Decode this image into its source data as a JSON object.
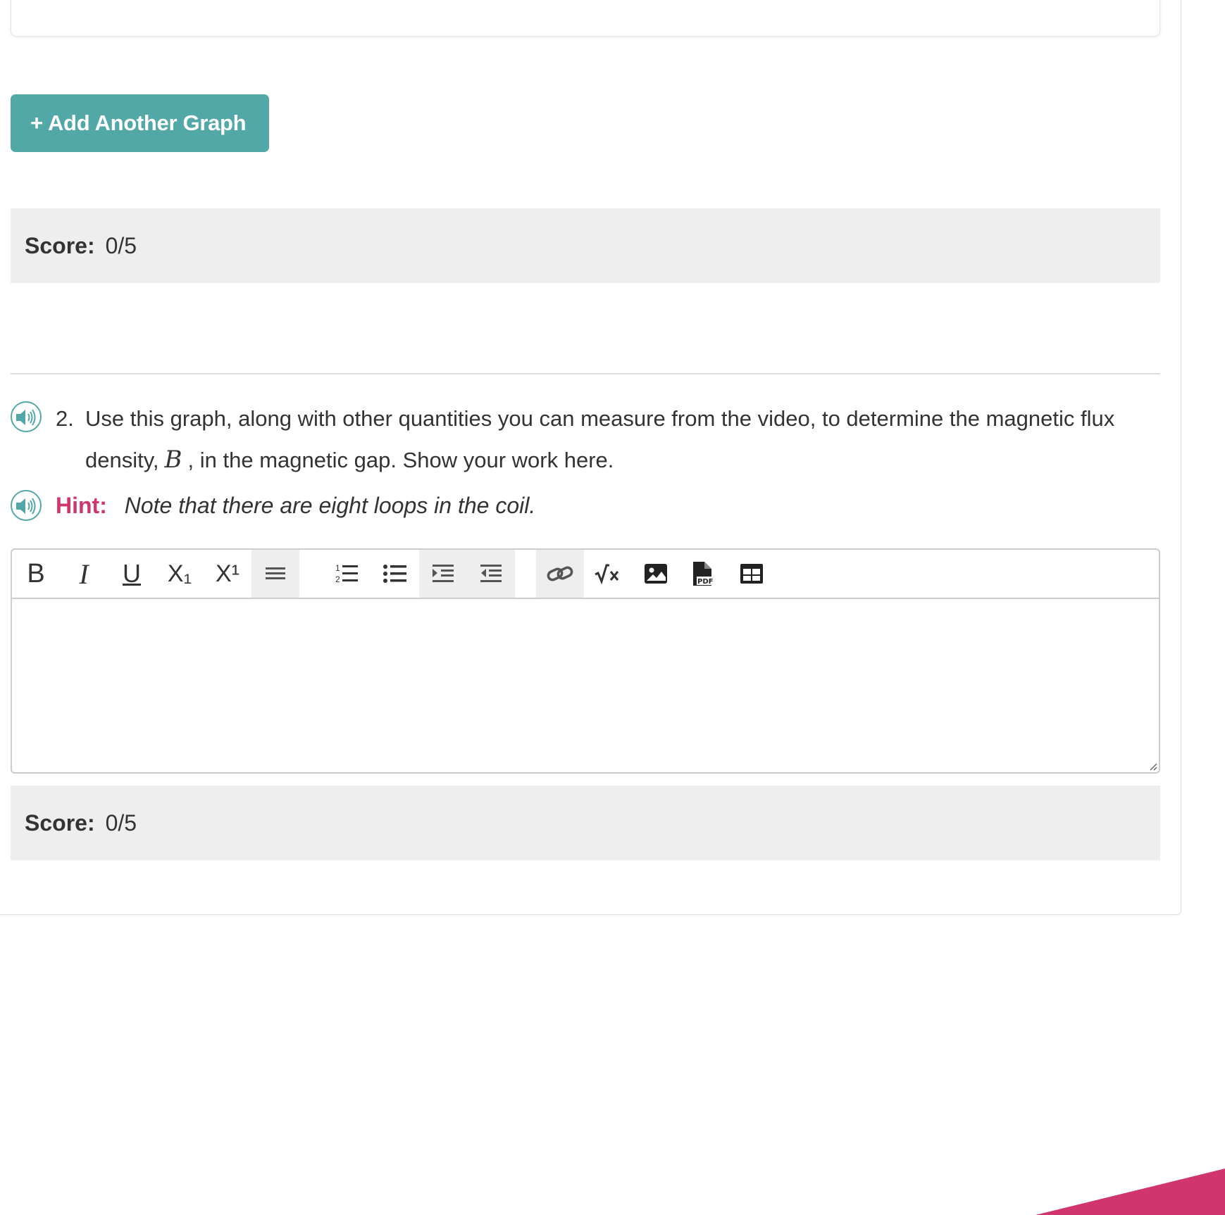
{
  "add_graph": {
    "label": "+ Add Another Graph"
  },
  "score_1": {
    "label": "Score:",
    "value": "0/5"
  },
  "question": {
    "number": "2.",
    "text_before": "Use this graph, along with other quantities you can measure from the video, to determine the magnetic flux density,",
    "variable": "B",
    "text_after": ", in the magnetic gap. Show your work here."
  },
  "hint": {
    "label": "Hint:",
    "text": "Note that there are eight loops in the coil."
  },
  "editor": {
    "toolbar": {
      "bold": "B",
      "italic": "I",
      "underline": "U",
      "subscript": "X₁",
      "superscript": "X¹"
    },
    "body_text": ""
  },
  "score_2": {
    "label": "Score:",
    "value": "0/5"
  },
  "colors": {
    "accent": "#52a8a6",
    "hint": "#d0366d",
    "score_bg": "#eeeeee",
    "corner": "#d0366d"
  }
}
